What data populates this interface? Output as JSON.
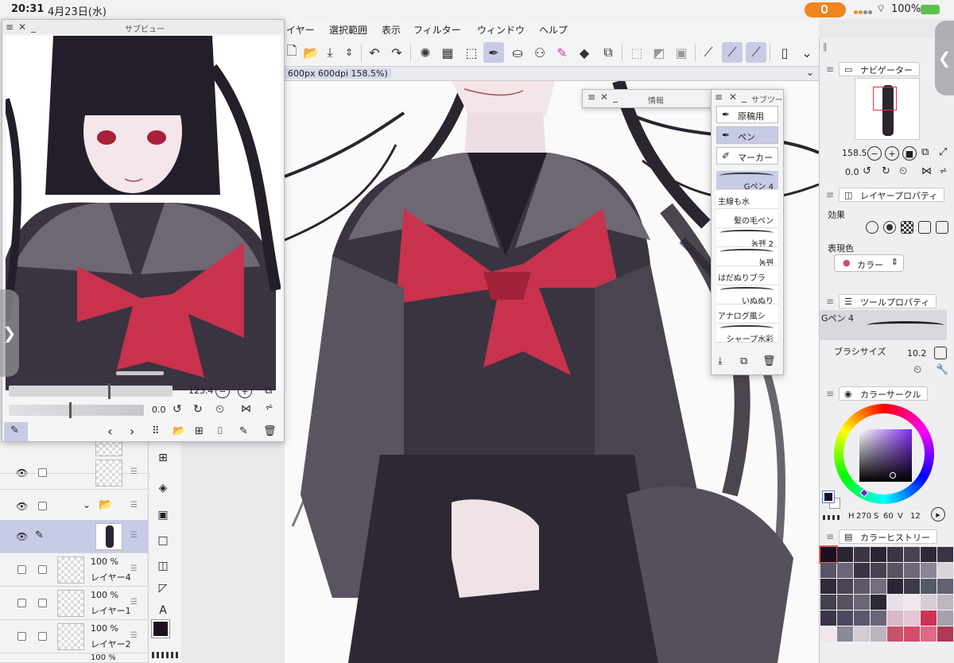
{
  "status_bar": {
    "time": "20:31",
    "date": "4月23日(水)",
    "battery": "100%"
  },
  "menu": {
    "items": [
      "イヤー",
      "選択範囲",
      "表示",
      "フィルター",
      "ウィンドウ",
      "ヘルプ"
    ]
  },
  "canvas_tab": {
    "label": "600px 600dpi 158.5%)"
  },
  "subview": {
    "title": "サブビュー",
    "zoom": "123.4",
    "rotation": "0.0"
  },
  "info_window": {
    "title": "情報"
  },
  "subtool": {
    "title": "サブツー",
    "tabs": [
      "原稿用",
      "ペン",
      "マーカー"
    ],
    "brushes": [
      "Gペン 4",
      "主線も水",
      "髪の毛ペン",
      "농펜 2",
      "농펜",
      "はだぬりブラ",
      "いぬぬり",
      "アナログ風シ",
      "シャープ水彩"
    ]
  },
  "navigator": {
    "title": "ナビゲーター",
    "zoom": "158.5",
    "rotation": "0.0"
  },
  "layer_property": {
    "title": "レイヤープロパティ",
    "effect_label": "効果",
    "color_label": "表現色",
    "color_value": "カラー"
  },
  "tool_property": {
    "title": "ツールプロパティ",
    "brush_name": "Gペン 4",
    "size_label": "ブラシサイズ",
    "size_value": "10.2"
  },
  "color_circle": {
    "title": "カラーサークル",
    "h_label": "H",
    "h": "270",
    "s_label": "S",
    "s": "60",
    "v_label": "V",
    "v": "12",
    "main_color": "#1a1020"
  },
  "color_history": {
    "title": "カラーヒストリー",
    "swatches": [
      "#1a1020",
      "#2c2633",
      "#3c3544",
      "#2a2330",
      "#3a3342",
      "#4a4254",
      "#2e2836",
      "#3b3445",
      "#5a5466",
      "#6c6577",
      "#3a3344",
      "#48414f",
      "#595260",
      "#6e687a",
      "#8a8494",
      "#d9d4dc",
      "#302a38",
      "#4a4354",
      "#5e5868",
      "#736d7d",
      "#2b2533",
      "#3f3848",
      "#525a66",
      "#646072",
      "#44404e",
      "#57525e",
      "#6b6676",
      "#2c2834",
      "#e8e0e8",
      "#f2e6ee",
      "#d8cdd6",
      "#bfb6c2",
      "#3a3446",
      "#4e4860",
      "#5c5670",
      "#6a6478",
      "#d9b8c8",
      "#e5c6d2",
      "#cc3355",
      "#a8a0ac",
      "#f0e6ec",
      "#8c8896",
      "#d3cad2",
      "#bcb4be",
      "#c7526b",
      "#d64b6a",
      "#e06a85",
      "#b03a55"
    ]
  },
  "layers": [
    {
      "pct": "",
      "name": ""
    },
    {
      "pct": "",
      "name": ""
    },
    {
      "pct": "",
      "name": ""
    },
    {
      "pct": "",
      "name": ""
    },
    {
      "pct": "100 %",
      "name": "レイヤー4"
    },
    {
      "pct": "100 %",
      "name": "レイヤー1"
    },
    {
      "pct": "100 %",
      "name": "レイヤー2"
    },
    {
      "pct": "100 %",
      "name": ""
    }
  ],
  "colors": {
    "accent": "#c9cbe6",
    "bow": "#c8324c",
    "uniform": "#2b2530"
  }
}
